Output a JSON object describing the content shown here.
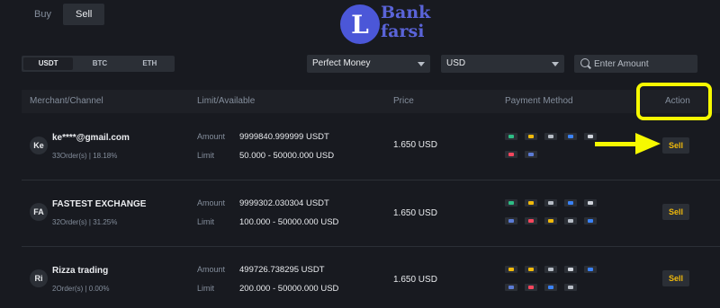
{
  "tabs": {
    "buy": "Buy",
    "sell": "Sell"
  },
  "logo": {
    "letter": "L",
    "line1": "Bank",
    "line2": "farsi"
  },
  "coins": [
    "USDT",
    "BTC",
    "ETH"
  ],
  "filters": {
    "payment_selected": "Perfect Money",
    "fiat_selected": "USD",
    "amount_placeholder": "Enter Amount"
  },
  "columns": {
    "merchant": "Merchant/Channel",
    "limit": "Limit/Available",
    "price": "Price",
    "payment": "Payment Method",
    "action": "Action"
  },
  "labels": {
    "amount": "Amount",
    "limit": "Limit"
  },
  "rows": [
    {
      "initials": "Ke",
      "name": "ke****@gmail.com",
      "stats": "33Order(s) | 18.18%",
      "amount": "9999840.999999 USDT",
      "limit": "50.000 - 50000.000 USD",
      "price": "1.650 USD",
      "action": "Sell"
    },
    {
      "initials": "FA",
      "name": "FASTEST EXCHANGE",
      "stats": "32Order(s) | 31.25%",
      "amount": "9999302.030304 USDT",
      "limit": "100.000 - 50000.000 USD",
      "price": "1.650 USD",
      "action": "Sell"
    },
    {
      "initials": "Ri",
      "name": "Rizza trading",
      "stats": "2Order(s) | 0.00%",
      "amount": "499726.738295 USDT",
      "limit": "200.000 - 50000.000 USD",
      "price": "1.650 USD",
      "action": "Sell"
    }
  ],
  "colors": {
    "background": "#181a20",
    "accent": "#f0b90b",
    "highlight": "#f6f900",
    "logo": "#4b57d8"
  }
}
